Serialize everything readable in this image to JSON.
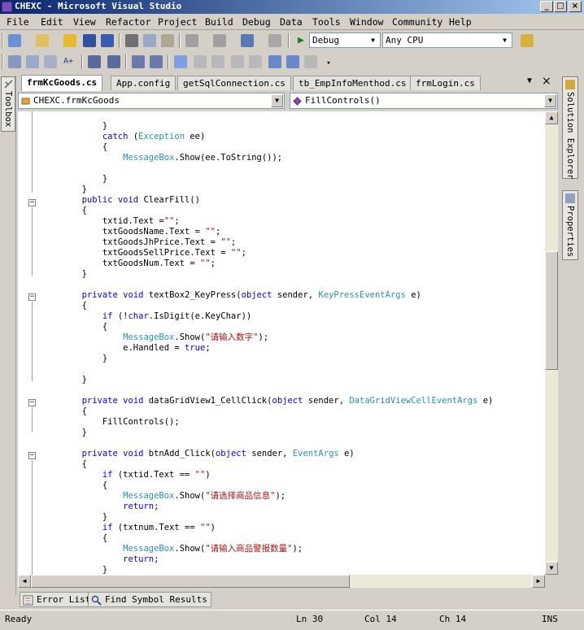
{
  "window": {
    "title": "CHEXC - Microsoft Visual Studio"
  },
  "menu": [
    "File",
    "Edit",
    "View",
    "Refactor",
    "Project",
    "Build",
    "Debug",
    "Data",
    "Tools",
    "Window",
    "Community",
    "Help"
  ],
  "toolbar": {
    "config": "Debug",
    "platform": "Any CPU"
  },
  "toolbox_label": "Toolbox",
  "right_panels": [
    "Solution Explorer",
    "Properties"
  ],
  "doc_tabs": [
    "frmKcGoods.cs",
    "App.config",
    "getSqlConnection.cs",
    "tb_EmpInfoMenthod.cs",
    "frmLogin.cs"
  ],
  "nav": {
    "class_combo": "CHEXC.frmKcGoods",
    "member_combo": "FillControls()"
  },
  "code_lines": [
    "            }",
    "            catch (Exception ee)",
    "            {",
    "                MessageBox.Show(ee.ToString());",
    "",
    "            }",
    "        }",
    "        public void ClearFill()",
    "        {",
    "            txtid.Text =\"\";",
    "            txtGoodsName.Text = \"\";",
    "            txtGoodsJhPrice.Text = \"\";",
    "            txtGoodsSellPrice.Text = \"\";",
    "            txtGoodsNum.Text = \"\";",
    "        }",
    "",
    "        private void textBox2_KeyPress(object sender, KeyPressEventArgs e)",
    "        {",
    "            if (!char.IsDigit(e.KeyChar))",
    "            {",
    "                MessageBox.Show(\"请输入数字\");",
    "                e.Handled = true;",
    "            }",
    "",
    "        }",
    "",
    "        private void dataGridView1_CellClick(object sender, DataGridViewCellEventArgs e)",
    "        {",
    "            FillControls();",
    "        }",
    "",
    "        private void btnAdd_Click(object sender, EventArgs e)",
    "        {",
    "            if (txtid.Text == \"\")",
    "            {",
    "                MessageBox.Show(\"请选择商品信息\");",
    "                return;",
    "            }",
    "            if (txtnum.Text == \"\")",
    "            {",
    "                MessageBox.Show(\"请输入商品警报数量\");",
    "                return;",
    "            }"
  ],
  "bottom_tabs": [
    "Error List",
    "Find Symbol Results"
  ],
  "status": {
    "ready": "Ready",
    "line": "Ln 30",
    "col": "Col 14",
    "ch": "Ch 14",
    "mode": "INS"
  },
  "colors": {
    "keyword": "#0000ff",
    "type": "#2b91af",
    "string": "#a31515"
  }
}
